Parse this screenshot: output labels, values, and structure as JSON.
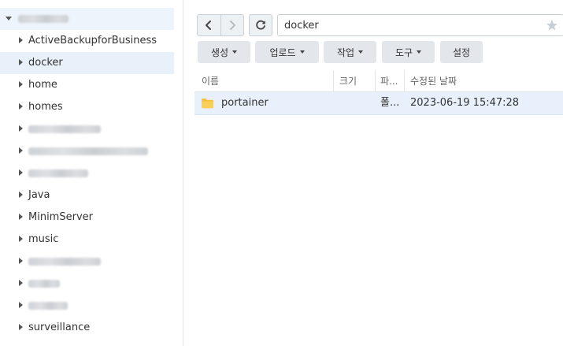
{
  "sidebar": {
    "items": [
      {
        "label": "ActiveBackupforBusiness"
      },
      {
        "label": "docker"
      },
      {
        "label": "home"
      },
      {
        "label": "homes"
      },
      {
        "label": "Java"
      },
      {
        "label": "MinimServer"
      },
      {
        "label": "music"
      },
      {
        "label": "surveillance"
      }
    ]
  },
  "nav": {
    "back_icon": "chevron-left-icon",
    "forward_icon": "chevron-right-icon",
    "refresh_icon": "refresh-icon"
  },
  "path": {
    "value": "docker"
  },
  "toolbar": {
    "create": "생성",
    "upload": "업로드",
    "action": "작업",
    "tools": "도구",
    "settings": "설정"
  },
  "table": {
    "columns": [
      "이름",
      "크기",
      "파...",
      "수정된 날짜"
    ],
    "rows": [
      {
        "name": "portainer",
        "size": "",
        "type": "폴...",
        "modified": "2023-06-19 15:47:28"
      }
    ]
  },
  "colors": {
    "selected_row": "#e8f1fb",
    "folder": "#f5c142",
    "toolbar_button": "#e3e7ec"
  }
}
